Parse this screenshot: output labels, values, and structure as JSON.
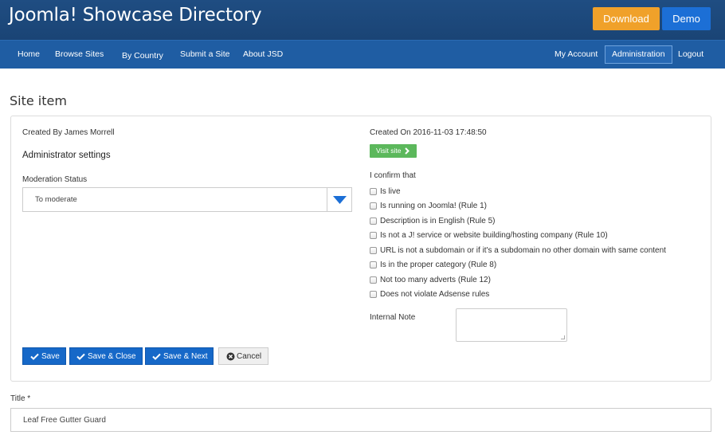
{
  "header": {
    "brand": "Joomla! Showcase Directory",
    "download_label": "Download",
    "demo_label": "Demo"
  },
  "nav": {
    "left": [
      "Home",
      "Browse Sites",
      "By Country",
      "Submit a Site",
      "About JSD"
    ],
    "right": [
      "My Account",
      "Administration",
      "Logout"
    ],
    "active": "Administration"
  },
  "page": {
    "title": "Site item"
  },
  "panel": {
    "created_by": "Created By James Morrell",
    "admin_settings": "Administrator settings",
    "moderation_label": "Moderation Status",
    "moderation_value": "To moderate",
    "created_on": "Created On 2016-11-03 17:48:50",
    "visit_label": "Visit site",
    "confirm_heading": "I confirm that",
    "checks": [
      "Is live",
      "Is running on Joomla! (Rule 1)",
      "Description is in English (Rule 5)",
      "Is not a J! service or website building/hosting company (Rule 10)",
      "URL is not a subdomain or if it's a subdomain no other domain with same content",
      "Is in the proper category (Rule 8)",
      "Not too many adverts (Rule 12)",
      "Does not violate Adsense rules"
    ],
    "internal_note_label": "Internal Note"
  },
  "actions": {
    "save": "Save",
    "save_close": "Save & Close",
    "save_next": "Save & Next",
    "cancel": "Cancel"
  },
  "form": {
    "title_label": "Title *",
    "title_value": "Leaf Free Gutter Guard"
  },
  "colors": {
    "header_bg": "#1f4d82",
    "nav_bg": "#1f5da3",
    "download": "#f0a12a",
    "demo": "#1c6fd6",
    "primary_button": "#1668c8",
    "visit_button": "#5cb85c"
  },
  "icons": {
    "visit": "chevron-right-icon",
    "select": "caret-down-icon",
    "save": "check-icon",
    "cancel": "times-circle-icon"
  }
}
